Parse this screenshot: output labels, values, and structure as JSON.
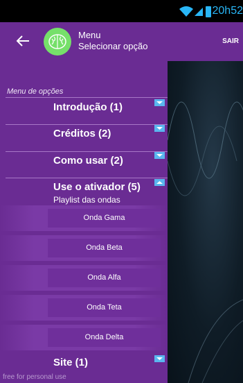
{
  "status_bar": {
    "time": "20h52"
  },
  "app_bar": {
    "title": "Menu",
    "subtitle": "Selecionar opção",
    "action_label": "SAIR"
  },
  "drawer": {
    "caption": "Menu de opções",
    "groups": [
      {
        "label": "Introdução (1)",
        "expanded": false
      },
      {
        "label": "Créditos (2)",
        "expanded": false
      },
      {
        "label": "Como usar (2)",
        "expanded": false
      },
      {
        "label": "Use o ativador (5)",
        "expanded": true,
        "description": "Playlist das ondas",
        "items": [
          "Onda Gama",
          "Onda Beta",
          "Onda Alfa",
          "Onda Teta",
          "Onda Delta"
        ]
      },
      {
        "label": "Site (1)",
        "expanded": false
      }
    ],
    "watermark": "free for personal use"
  },
  "colors": {
    "drawer": "#6a2c93",
    "indicator": "#5ab6ee",
    "avatar": "#76e06a",
    "status_text": "#29b6f6"
  }
}
